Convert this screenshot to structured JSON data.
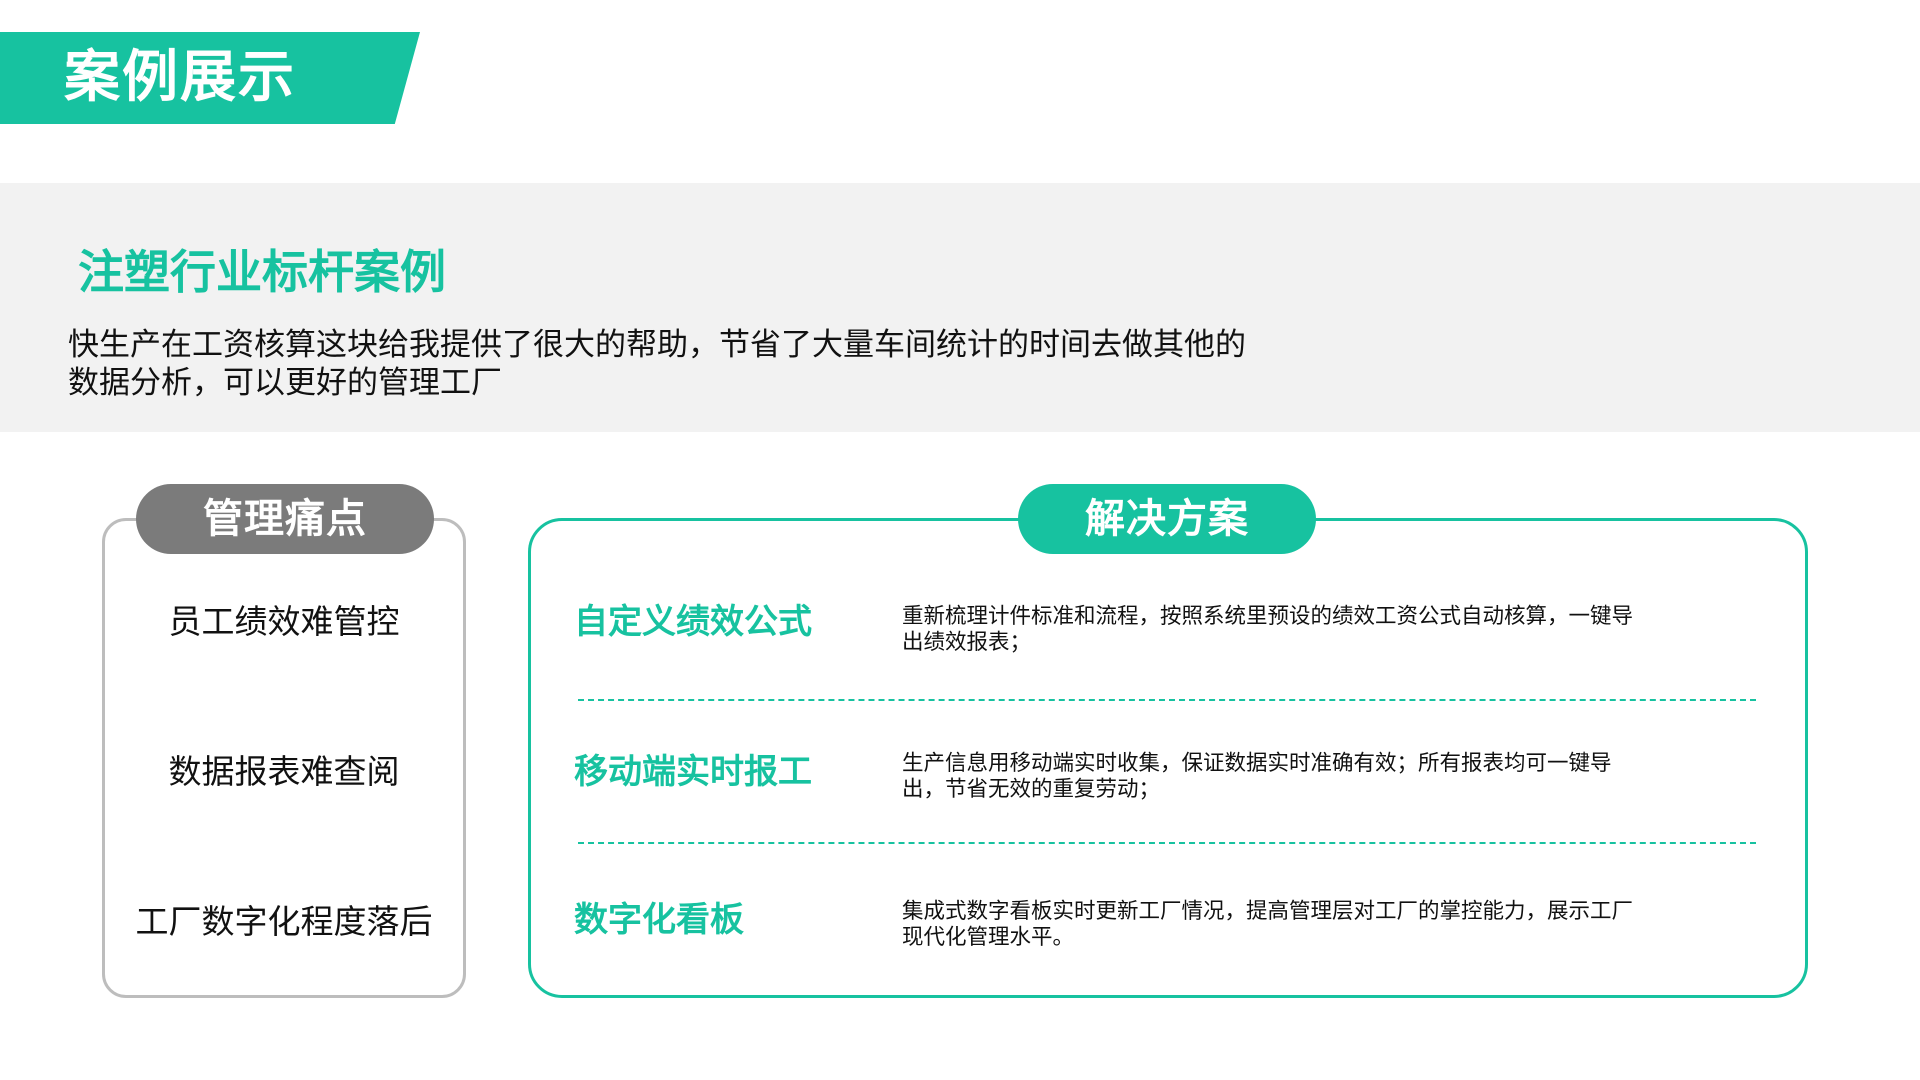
{
  "header": {
    "title": "案例展示"
  },
  "intro": {
    "case_title": "注塑行业标杆案例",
    "description": "快生产在工资核算这块给我提供了很大的帮助，节省了大量车间统计的时间去做其他的数据分析，可以更好的管理工厂"
  },
  "pain_points": {
    "title": "管理痛点",
    "items": [
      {
        "label": "员工绩效难管控"
      },
      {
        "label": "数据报表难查阅"
      },
      {
        "label": "工厂数字化程度落后"
      }
    ]
  },
  "solutions": {
    "title": "解决方案",
    "items": [
      {
        "title": "自定义绩效公式",
        "description": "重新梳理计件标准和流程，按照系统里预设的绩效工资公式自动核算，一键导出绩效报表；"
      },
      {
        "title": "移动端实时报工",
        "description": "生产信息用移动端实时收集，保证数据实时准确有效；所有报表均可一键导出，节省无效的重复劳动；"
      },
      {
        "title": "数字化看板",
        "description": "集成式数字看板实时更新工厂情况，提高管理层对工厂的掌控能力，展示工厂现代化管理水平。"
      }
    ]
  },
  "colors": {
    "accent": "#17c2a0",
    "pain_pill": "#7b7b7b",
    "band": "#f2f2f2",
    "pain_border": "#bdbdbd"
  }
}
